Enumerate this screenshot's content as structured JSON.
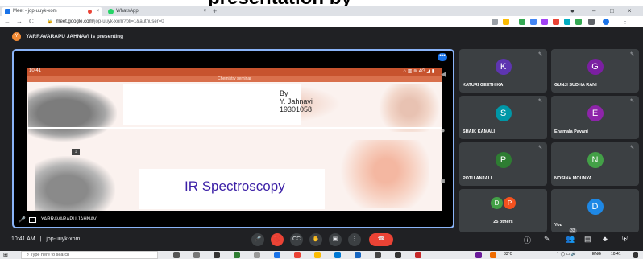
{
  "page_header": {
    "text": "presentation by"
  },
  "browser": {
    "tabs": [
      {
        "title": "Meet - jop-uuyk-xom",
        "close": "×",
        "icon_color": "#1a73e8"
      },
      {
        "title": "WhatsApp",
        "close": "×",
        "icon_color": "#25d366"
      }
    ],
    "new_tab": "+",
    "window_controls": {
      "minimize": "–",
      "maximize": "□",
      "close": "×"
    },
    "url_domain": "meet.google.com",
    "url_path": "/jop-uuyk-xom?pli=1&authuser=0",
    "nav": {
      "back": "←",
      "forward": "→",
      "reload": "C"
    }
  },
  "meet": {
    "presenting_initial": "Y",
    "presenting_text": "YARRAVARAPU JAHNAVI is presenting",
    "presenter_tile": {
      "more": "•••",
      "label": "YARRAVARAPU JAHNAVI",
      "phone_time": "10:41",
      "phone_status": "⌂ ▥ ≋ 4G ◢ ▮",
      "app_title": "Chemistry seminar",
      "by": "By",
      "author": "Y. Jahnavi",
      "roll": "19301058",
      "slide_title": "IR Spectroscopy",
      "slide_chip": "1"
    },
    "participants": [
      {
        "initial": "K",
        "name": "KATURI GEETHIKA",
        "color": "#5e35b1"
      },
      {
        "initial": "G",
        "name": "GUNJI SUDHA RANI",
        "color": "#7b1fa2"
      },
      {
        "initial": "S",
        "name": "SHAIK KAMALI",
        "color": "#0097a7"
      },
      {
        "initial": "E",
        "name": "Enamala Pavani",
        "color": "#8e24aa"
      },
      {
        "initial": "P",
        "name": "POTU ANJALI",
        "color": "#2e7d32"
      },
      {
        "initial": "N",
        "name": "NOSINA MOUNYA",
        "color": "#43a047"
      }
    ],
    "others": {
      "initials": [
        "D",
        "P"
      ],
      "colors": [
        "#43a047",
        "#f4511e"
      ],
      "label": "25 others"
    },
    "you": {
      "initial": "D",
      "name": "You",
      "color": "#1e88e5"
    },
    "bottom": {
      "time": "10:41 AM",
      "separator": "|",
      "meeting_code": "jop-uuyk-xom",
      "people_count": "33",
      "buttons": [
        "🎤",
        "🚫",
        "CC",
        "✋",
        "▣",
        "⋮",
        "☎"
      ]
    }
  },
  "taskbar": {
    "search_placeholder": "Type here to search",
    "weather": "33°C",
    "lang": "ENG",
    "time": "10:41"
  }
}
